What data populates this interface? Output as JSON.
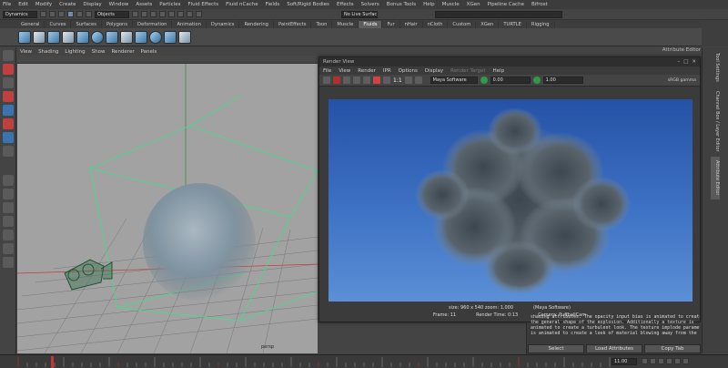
{
  "menubar": {
    "items": [
      "File",
      "Edit",
      "Modify",
      "Create",
      "Display",
      "Window",
      "Assets",
      "Particles",
      "Fluid Effects",
      "Fluid nCache",
      "Fields",
      "Soft/Rigid Bodies",
      "Effects",
      "Solvers",
      "Bonus Tools",
      "Help",
      "Muscle",
      "XGen",
      "Pipeline Cache",
      "Bifrost"
    ]
  },
  "status": {
    "mode": "Dynamics",
    "objects": "Objects",
    "live_surface": "No Live Surface"
  },
  "shelf_tabs": [
    "General",
    "Curves",
    "Surfaces",
    "Polygons",
    "Deformation",
    "Animation",
    "Dynamics",
    "Rendering",
    "PaintEffects",
    "Toon",
    "Muscle",
    "Fluids",
    "Fur",
    "nHair",
    "nCloth",
    "Custom",
    "XGen",
    "TURTLE",
    "Rigging"
  ],
  "shelf_active": "Fluids",
  "viewport": {
    "menu": [
      "View",
      "Shading",
      "Lighting",
      "Show",
      "Renderer",
      "Panels"
    ],
    "camera_label": "persp"
  },
  "render_view": {
    "title": "Render View",
    "menu": [
      "File",
      "View",
      "Render",
      "IPR",
      "Options",
      "Display",
      "Render Target",
      "Help"
    ],
    "ratio": "1:1",
    "renderer": "Maya Software",
    "exposure": "0.00",
    "gamma": "1.00",
    "color_space": "sRGB gamma",
    "size_info": "size: 960 x 540 zoom: 1.000",
    "renderer_info": "(Maya Software)",
    "frame": "Frame: 11",
    "render_time": "Render Time: 0:13",
    "camera": "Camera: PuffballCam"
  },
  "attribute_editor": {
    "header": "Attribute Editor",
    "note": "shading attributes. The opacity input bias is animated to create\nthe general shape of the explosion. Additionally a texture is\nanimated to create a turbulent look. The texture implode parameter\nis animated to create a look of material blowing away from the",
    "select_label": "Select",
    "load_label": "Load Attributes",
    "copy_label": "Copy Tab"
  },
  "side_tabs": [
    "Tool Settings",
    "Channel Box / Layer Editor",
    "Attribute Editor"
  ],
  "timeline": {
    "current_frame": "11.00"
  }
}
